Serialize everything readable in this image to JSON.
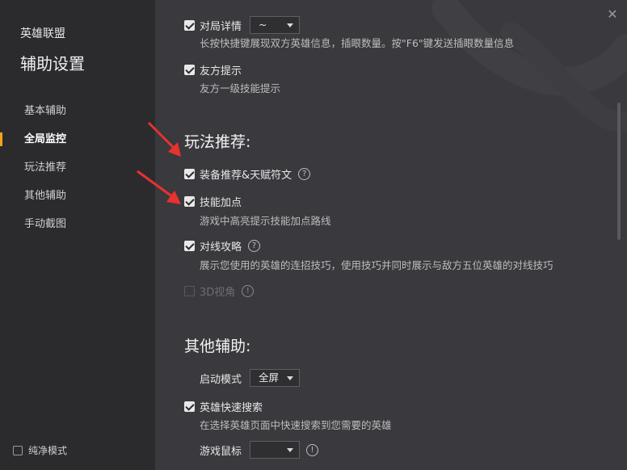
{
  "sidebar": {
    "app_title": "英雄联盟",
    "page_title": "辅助设置",
    "items": [
      {
        "label": "基本辅助"
      },
      {
        "label": "全局监控"
      },
      {
        "label": "玩法推荐"
      },
      {
        "label": "其他辅助"
      },
      {
        "label": "手动截图"
      }
    ],
    "active_index": 1,
    "pure_mode_label": "纯净模式"
  },
  "main": {
    "top_row": {
      "label": "对局详情",
      "select_value": "~",
      "desc": "长按快捷键展现双方英雄信息，插眼数量。按\"F6\"键发送插眼数量信息"
    },
    "ally_tip": {
      "label": "友方提示",
      "desc": "友方一级技能提示"
    },
    "section_play": "玩法推荐:",
    "equip": {
      "label": "装备推荐&天赋符文"
    },
    "skill": {
      "label": "技能加点",
      "desc": "游戏中高亮提示技能加点路线"
    },
    "lane": {
      "label": "对线攻略",
      "desc": "展示您使用的英雄的连招技巧，使用技巧并同时展示与敌方五位英雄的对线技巧"
    },
    "view3d": {
      "label": "3D视角"
    },
    "section_other": "其他辅助:",
    "launch_mode": {
      "label": "启动模式",
      "value": "全屏"
    },
    "hero_search": {
      "label": "英雄快速搜索",
      "desc": "在选择英雄页面中快速搜索到您需要的英雄"
    },
    "mouse": {
      "label": "游戏鼠标",
      "value": ""
    }
  },
  "icons": {
    "help": "?",
    "info": "!",
    "close": "✕"
  },
  "colors": {
    "accent": "#f0a31a",
    "arrow": "#e8322e"
  }
}
